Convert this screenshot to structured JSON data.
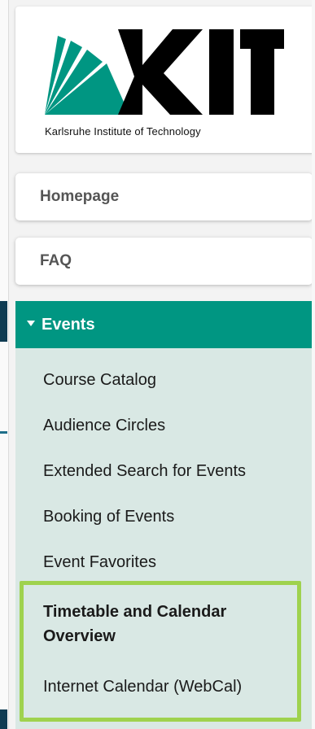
{
  "logo": {
    "caption": "Karlsruhe Institute of Technology",
    "brand_color": "#009682",
    "letters": "KIT"
  },
  "nav": {
    "homepage": "Homepage",
    "faq": "FAQ",
    "events": {
      "label": "Events",
      "expanded": true,
      "items": [
        "Course Catalog",
        "Audience Circles",
        "Extended Search for Events",
        "Booking of Events",
        "Event Favorites",
        "Timetable and Calendar Overview",
        "Internet Calendar (WebCal)"
      ]
    }
  },
  "colors": {
    "accent": "#009682",
    "panel": "#d9e8e4",
    "highlight": "#9fd24e"
  }
}
